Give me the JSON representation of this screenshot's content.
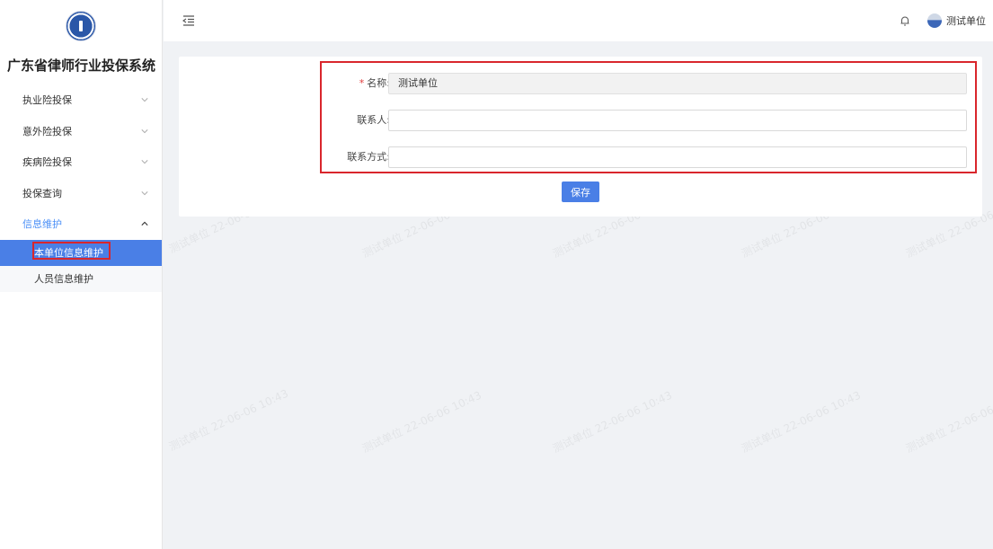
{
  "sidebar": {
    "title": "广东省律师行业投保系统",
    "menu": [
      {
        "label": "执业险投保",
        "expanded": false
      },
      {
        "label": "意外险投保",
        "expanded": false
      },
      {
        "label": "疾病险投保",
        "expanded": false
      },
      {
        "label": "投保查询",
        "expanded": false
      },
      {
        "label": "信息维护",
        "expanded": true
      }
    ],
    "submenu": [
      {
        "label": "本单位信息维护",
        "active": true
      },
      {
        "label": "人员信息维护",
        "active": false
      }
    ]
  },
  "header": {
    "user_name": "测试单位"
  },
  "form": {
    "name_label": "名称:",
    "name_required_mark": "*",
    "name_value": "测试单位",
    "contact_label": "联系人:",
    "contact_value": "",
    "contact_method_label": "联系方式:",
    "contact_method_value": "",
    "save_label": "保存"
  },
  "watermark": {
    "text": "测试单位 22-06-06 10:43"
  },
  "colors": {
    "accent": "#4a7fe6",
    "highlight_border": "#d9262c",
    "required": "#e03a3a"
  }
}
